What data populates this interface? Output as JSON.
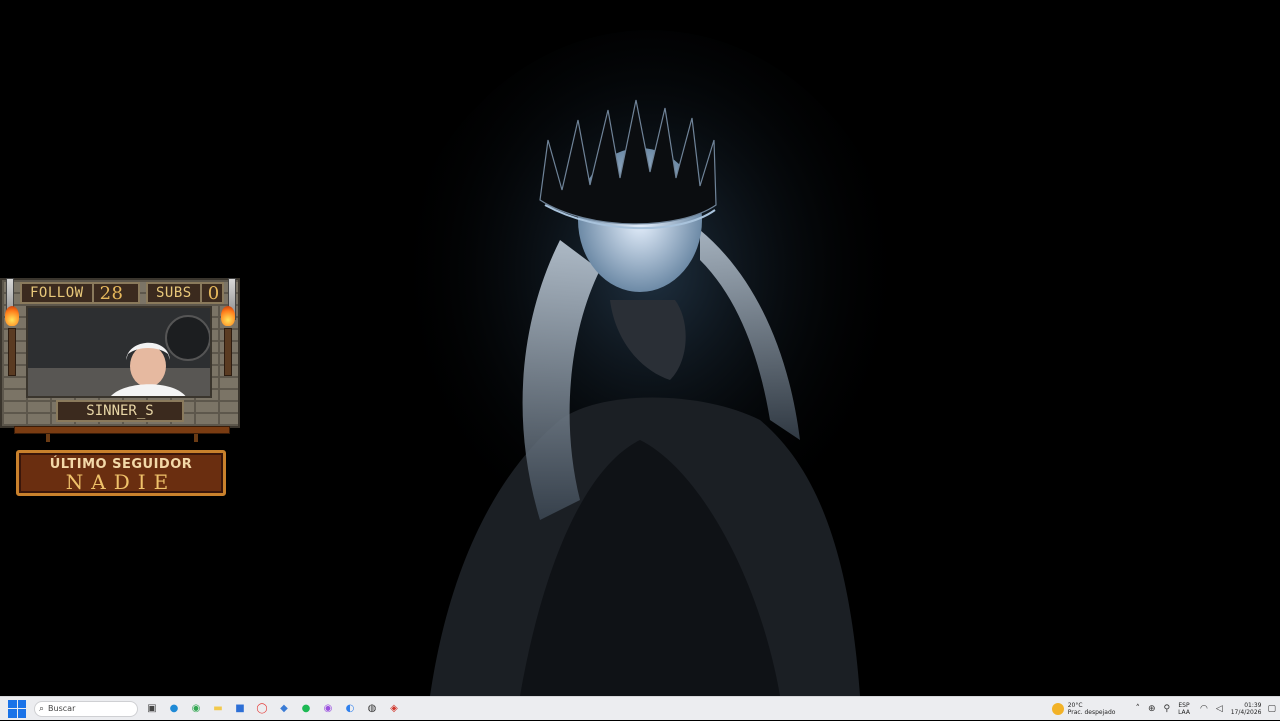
{
  "overlay": {
    "follow_label": "FOLLOW",
    "follow_count": "28",
    "subs_label": "SUBS",
    "subs_count": "0",
    "streamer_name": "SINNER_S",
    "last_follower_title": "ÚLTIMO SEGUIDOR",
    "last_follower_name": "NADIE"
  },
  "taskbar": {
    "search_placeholder": "Buscar",
    "search_icon": "search-icon",
    "pinned_apps": [
      {
        "name": "task-view",
        "glyph": "▣",
        "color": "#444444"
      },
      {
        "name": "edge",
        "glyph": "●",
        "color": "#1f8ad6"
      },
      {
        "name": "chrome",
        "glyph": "◉",
        "color": "#34a853"
      },
      {
        "name": "file-explorer",
        "glyph": "▬",
        "color": "#f2c94c"
      },
      {
        "name": "store",
        "glyph": "■",
        "color": "#2d6fd6"
      },
      {
        "name": "opera",
        "glyph": "◯",
        "color": "#e53935"
      },
      {
        "name": "app-blue",
        "glyph": "◆",
        "color": "#3a7bd5"
      },
      {
        "name": "spotify",
        "glyph": "●",
        "color": "#1db954"
      },
      {
        "name": "messenger",
        "glyph": "◉",
        "color": "#9b51e0"
      },
      {
        "name": "app-azure",
        "glyph": "◐",
        "color": "#2f80ed"
      },
      {
        "name": "obs",
        "glyph": "◍",
        "color": "#333333"
      },
      {
        "name": "app-red",
        "glyph": "◈",
        "color": "#d0362c"
      }
    ],
    "weather_temp": "20°C",
    "weather_desc": "Prac. despejado",
    "lang_top": "ESP",
    "lang_bottom": "LAA",
    "time": "01:39",
    "date": "17/4/2026"
  }
}
